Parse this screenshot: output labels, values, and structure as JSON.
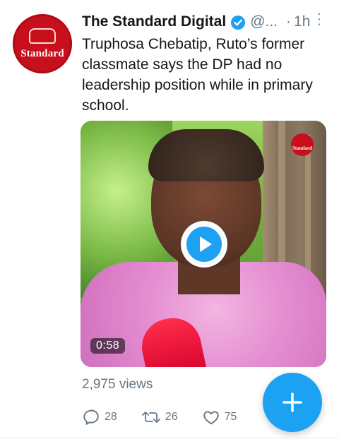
{
  "tweet": {
    "author_name": "The Standard Digital",
    "handle": "@...",
    "time": "1h",
    "avatar_text": "Standard",
    "text": "Truphosa Chebatip, Ruto’s former classmate says the DP had no leadership position while in primary school.",
    "media": {
      "duration": "0:58",
      "watermark_text": "Standard"
    },
    "views": "2,975 views",
    "actions": {
      "replies": "28",
      "retweets": "26",
      "likes": "75"
    }
  },
  "colors": {
    "accent": "#1da1f2",
    "brand_red": "#c8101c",
    "muted_text": "#657786"
  },
  "icons": [
    "verified-icon",
    "more-icon",
    "play-icon",
    "reply-icon",
    "retweet-icon",
    "like-icon",
    "compose-plus-icon"
  ]
}
